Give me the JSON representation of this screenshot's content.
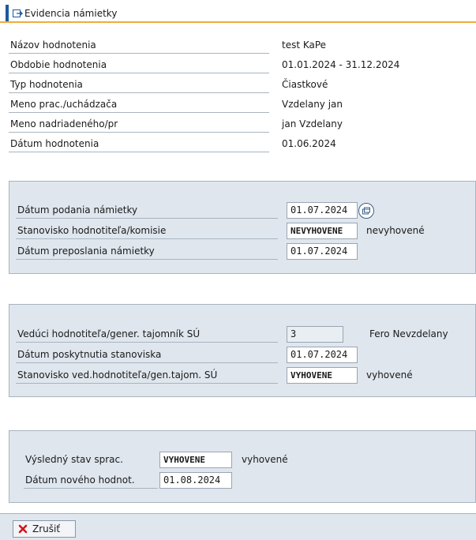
{
  "window": {
    "title": "Evidencia námietky"
  },
  "header_fields": [
    {
      "label": "Názov hodnotenia",
      "value": "test KaPe"
    },
    {
      "label": "Obdobie hodnotenia",
      "value": "01.01.2024 - 31.12.2024"
    },
    {
      "label": "Typ hodnotenia",
      "value": "Čiastkové"
    },
    {
      "label": "Meno prac./uchádzača",
      "value": "Vzdelany jan"
    },
    {
      "label": "Meno nadriadeného/pr",
      "value": "jan Vzdelany"
    },
    {
      "label": "Dátum hodnotenia",
      "value": "01.06.2024"
    }
  ],
  "objection": {
    "date_submitted": {
      "label": "Dátum podania námietky",
      "value": "01.07.2024"
    },
    "evaluator_opinion": {
      "label": "Stanovisko hodnotiteľa/komisie",
      "value": "NEVYHOVENE",
      "text": "nevyhovené"
    },
    "date_forwarded": {
      "label": "Dátum preposlania námietky",
      "value": "01.07.2024"
    }
  },
  "head": {
    "leader": {
      "label": "Vedúci hodnotiteľa/gener. tajomník SÚ",
      "value": "3",
      "text": "Fero Nevzdelany"
    },
    "date_opinion": {
      "label": "Dátum poskytnutia stanoviska",
      "value": "01.07.2024"
    },
    "leader_opinion": {
      "label": "Stanovisko ved.hodnotiteľa/gen.tajom. SÚ",
      "value": "VYHOVENE",
      "text": "vyhovené"
    }
  },
  "result": {
    "final_state": {
      "label": "Výsledný stav sprac.",
      "value": "VYHOVENE",
      "text": "vyhovené"
    },
    "new_date": {
      "label": "Dátum nového hodnot.",
      "value": "01.08.2024"
    }
  },
  "footer": {
    "cancel_label": "Zrušiť"
  },
  "colors": {
    "accent": "#1c5a9b",
    "title_underline": "#f0ac3c",
    "panel_bg": "#dfe6ee",
    "cancel_icon": "#d2161b"
  }
}
